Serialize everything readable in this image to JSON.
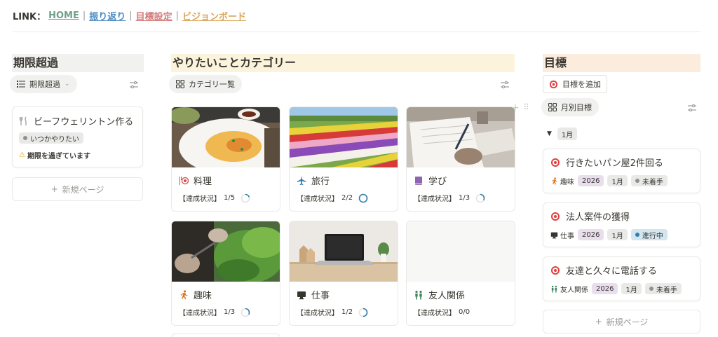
{
  "links": {
    "prefix": "LINK：",
    "items": [
      {
        "label": "HOME",
        "color": "#6fa08a"
      },
      {
        "label": "振り返り",
        "color": "#4f8dc4"
      },
      {
        "label": "目標設定",
        "color": "#d47a7a"
      },
      {
        "label": "ビジョンボード",
        "color": "#d9a65b"
      }
    ],
    "separator": "|"
  },
  "overdue": {
    "title": "期限超過",
    "title_bg": "#f1f1ef",
    "view_label": "期限超過",
    "card": {
      "title": "ビーフウェリントン作る",
      "tag": "いつかやりたい",
      "warning": "期限を過ぎています"
    },
    "new_page": "新規ページ"
  },
  "categories": {
    "title": "やりたいことカテゴリー",
    "title_bg": "#fbf3db",
    "view_label": "カテゴリ一覧",
    "status_prefix": "【達成状況】",
    "items": [
      {
        "name": "料理",
        "icon": "cooking-icon",
        "icon_color": "#d44c47",
        "done": 1,
        "total": 5,
        "progress": 0.2
      },
      {
        "name": "旅行",
        "icon": "airplane-icon",
        "icon_color": "#337ea9",
        "done": 2,
        "total": 2,
        "progress": 1.0
      },
      {
        "name": "学び",
        "icon": "book-icon",
        "icon_color": "#9065b0",
        "done": 1,
        "total": 3,
        "progress": 0.333
      },
      {
        "name": "趣味",
        "icon": "running-icon",
        "icon_color": "#d9730d",
        "done": 1,
        "total": 3,
        "progress": 0.333
      },
      {
        "name": "仕事",
        "icon": "desktop-icon",
        "icon_color": "#37352f",
        "done": 1,
        "total": 2,
        "progress": 0.5
      },
      {
        "name": "友人関係",
        "icon": "people-icon",
        "icon_color": "#448361",
        "done": 0,
        "total": 0,
        "progress": 0
      }
    ]
  },
  "goals": {
    "title": "目標",
    "title_bg": "#fbecdd",
    "add_button": "目標を追加",
    "view_label": "月別目標",
    "group_label": "1月",
    "items": [
      {
        "title": "行きたいパン屋2件回る",
        "category": "趣味",
        "cat_icon": "running-icon",
        "cat_color": "#d9730d",
        "year": "2026",
        "month": "1月",
        "status": "未着手",
        "status_style": "gray"
      },
      {
        "title": "法人案件の獲得",
        "category": "仕事",
        "cat_icon": "desktop-icon",
        "cat_color": "#37352f",
        "year": "2026",
        "month": "1月",
        "status": "進行中",
        "status_style": "blue"
      },
      {
        "title": "友達と久々に電話する",
        "category": "友人関係",
        "cat_icon": "people-icon",
        "cat_color": "#448361",
        "year": "2026",
        "month": "1月",
        "status": "未着手",
        "status_style": "gray"
      }
    ],
    "new_page": "新規ページ"
  },
  "colors": {
    "status_gray_dot": "#91918e",
    "status_blue_dot": "#337ea9",
    "ring": "#337ea9",
    "target": "#e03e3e"
  }
}
